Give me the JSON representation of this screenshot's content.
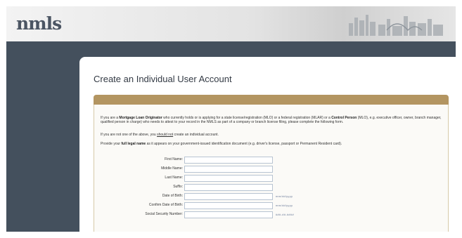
{
  "header": {
    "logo_text": "nmls"
  },
  "page": {
    "title": "Create an Individual User Account"
  },
  "intro": {
    "p1_a": "If you are a ",
    "p1_b": "Mortgage Loan Originator",
    "p1_c": " who currently holds or is applying for a state license/registration (MLO) or a federal registration (MLAR) or a ",
    "p1_d": "Control Person",
    "p1_e": " (MLO), e.g. executive officer, owner, branch manager, qualified person in charge) who needs to attest to your record in the NMLS as part of a company or branch license filing, please complete the following form.",
    "p2_a": "If you are not one of the above, you ",
    "p2_b": "should not",
    "p2_c": " create an individual account.",
    "p3_a": "Provide your ",
    "p3_b": "full legal name",
    "p3_c": " as it appears on your government-issued identification document (e.g. driver's license, passport or Permanent Resident card)."
  },
  "form": {
    "fields": [
      {
        "label": "First Name:",
        "value": "",
        "hint": ""
      },
      {
        "label": "Middle Name:",
        "value": "",
        "hint": ""
      },
      {
        "label": "Last Name:",
        "value": "",
        "hint": ""
      },
      {
        "label": "Suffix:",
        "value": "",
        "hint": ""
      },
      {
        "label": "Date of Birth:",
        "value": "",
        "hint": "mm/dd/yyyy"
      },
      {
        "label": "Confirm Date of Birth:",
        "value": "",
        "hint": "mm/dd/yyyy"
      },
      {
        "label": "Social Security Number:",
        "value": "",
        "hint": "###-##-####"
      }
    ]
  },
  "colors": {
    "header_band": "#b39561",
    "frame": "#44505d",
    "input_border": "#b8c4d2"
  }
}
